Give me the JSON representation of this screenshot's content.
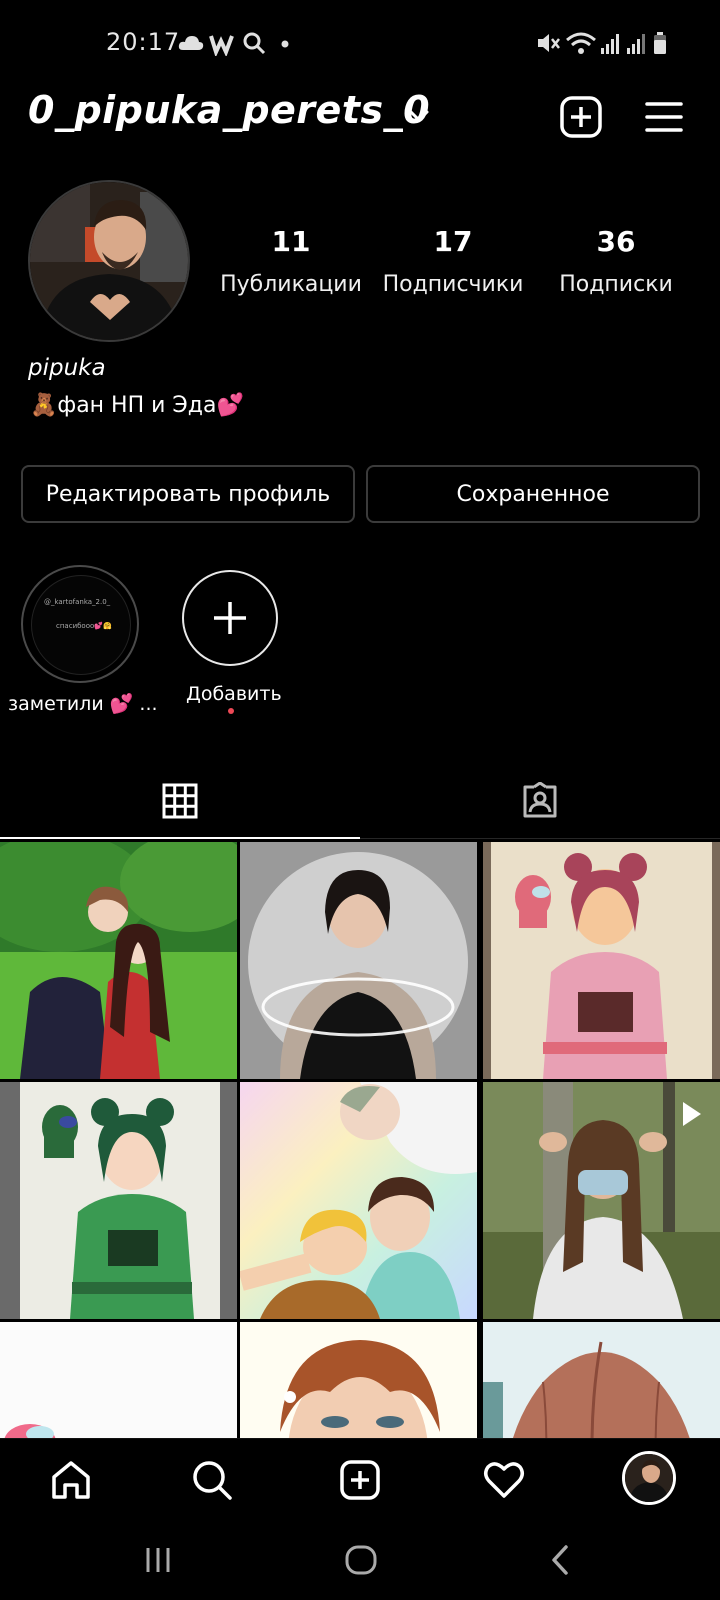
{
  "status_bar": {
    "time": "20:17"
  },
  "header": {
    "username": "0_pipuka_perets_0"
  },
  "profile": {
    "stats": [
      {
        "value": "11",
        "label": "Публикации"
      },
      {
        "value": "17",
        "label": "Подписчики"
      },
      {
        "value": "36",
        "label": "Подписки"
      }
    ],
    "display_name": "pipuka",
    "bio": "🧸фан НП и Эда💕"
  },
  "buttons": {
    "edit_profile": "Редактировать профиль",
    "saved": "Сохраненное"
  },
  "highlights": [
    {
      "label": "заметили 💕 ...",
      "mini_user": "@_kartofanka_2.0_",
      "mini_text": "спасибооо💕🤗"
    },
    {
      "label": "Добавить"
    }
  ],
  "tabs": [
    {
      "name": "grid",
      "icon": "grid-icon",
      "active": true
    },
    {
      "name": "tagged",
      "icon": "tagged-user-icon",
      "active": false
    }
  ],
  "posts": [
    {
      "name": "anime-couple-park",
      "video": false
    },
    {
      "name": "woman-portrait-edit",
      "video": false
    },
    {
      "name": "pink-girl-drawing",
      "video": false
    },
    {
      "name": "green-girl-drawing",
      "video": false
    },
    {
      "name": "boys-pastel-art",
      "video": false
    },
    {
      "name": "forest-girl-video",
      "video": true
    },
    {
      "name": "pink-sketch-partial",
      "video": false
    },
    {
      "name": "ginger-portrait-partial",
      "video": false
    },
    {
      "name": "hair-drawing-partial",
      "video": false
    }
  ],
  "bottom_nav": [
    "home-icon",
    "search-icon",
    "add-post-icon",
    "heart-icon",
    "profile-avatar"
  ],
  "colors": {
    "background": "#000000",
    "text": "#ffffff",
    "border": "#3b3b3b",
    "notification_dot": "#ed4956"
  }
}
